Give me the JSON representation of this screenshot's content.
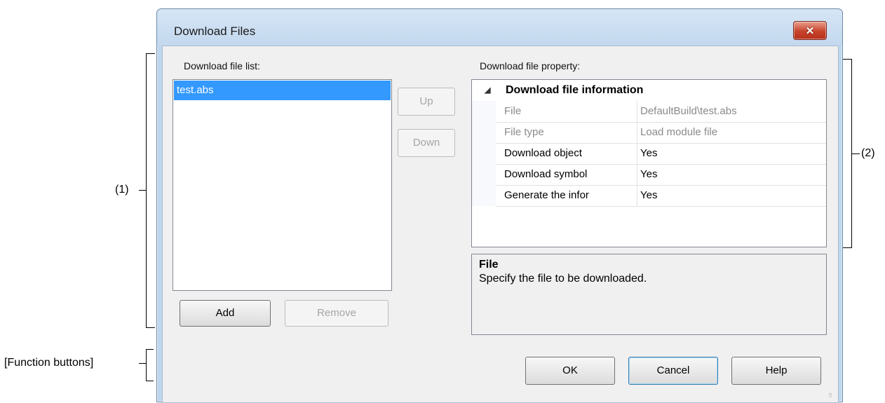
{
  "annotations": {
    "label1": "(1)",
    "label2": "(2)",
    "function_buttons": "[Function buttons]"
  },
  "window": {
    "title": "Download Files",
    "close_icon": "close-icon"
  },
  "file_list": {
    "label": "Download file list:",
    "items": [
      "test.abs"
    ],
    "up_button": "Up",
    "down_button": "Down",
    "add_button": "Add",
    "remove_button": "Remove"
  },
  "property": {
    "label": "Download file property:",
    "category": "Download file information",
    "rows": [
      {
        "key": "File",
        "value": "DefaultBuild\\test.abs",
        "readonly": true
      },
      {
        "key": "File type",
        "value": "Load module file",
        "readonly": true
      },
      {
        "key": "Download object",
        "value": "Yes",
        "readonly": false
      },
      {
        "key": "Download symbol",
        "value": "Yes",
        "readonly": false
      },
      {
        "key": "Generate the infor",
        "value": "Yes",
        "readonly": false
      }
    ],
    "description_title": "File",
    "description_text": "Specify the file to be downloaded."
  },
  "buttons": {
    "ok": "OK",
    "cancel": "Cancel",
    "help": "Help"
  },
  "colors": {
    "selection": "#3399ff",
    "close_button": "#c7432b"
  }
}
